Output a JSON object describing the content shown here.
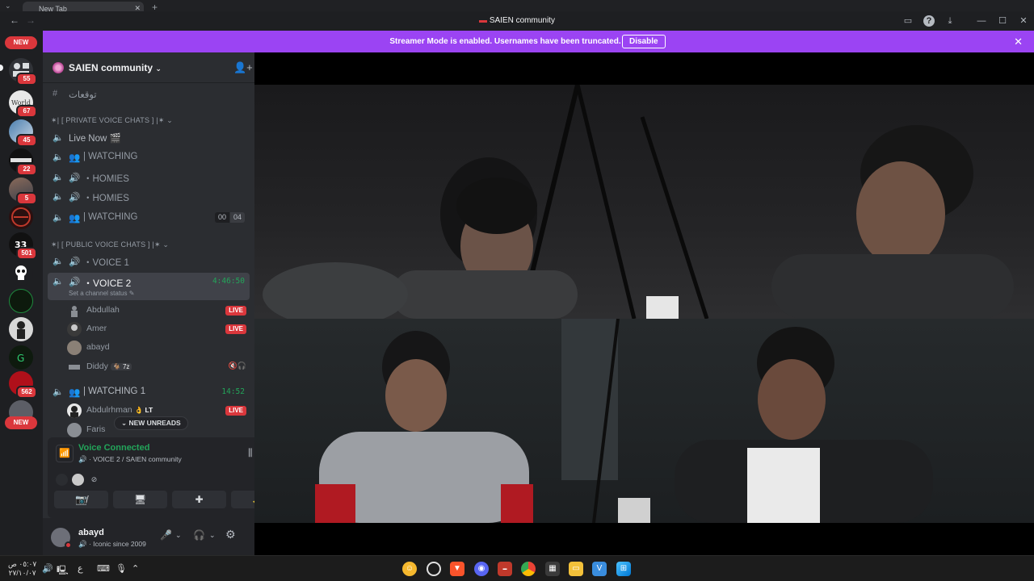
{
  "browser": {
    "tab_title": "New Tab"
  },
  "window": {
    "title": "SAIEN community"
  },
  "banner": {
    "text": "Streamer Mode is enabled. Usernames have been truncated.",
    "button": "Disable"
  },
  "rail": {
    "new_top": "NEW",
    "new_bottom": "NEW",
    "badges": [
      "55",
      "67",
      "45",
      "22",
      "5",
      "501",
      "562"
    ]
  },
  "sidebar": {
    "server_name": "SAIEN community",
    "arabic_channel": "توقعات",
    "cat_private": "✶| [ PRIVATE VOICE CHATS ] |✶",
    "live_now": "Live Now 🎬",
    "private_channels": [
      "| WATCHING",
      "・HOMIES",
      "・HOMIES",
      "| WATCHING"
    ],
    "watching_counts": [
      "00",
      "04"
    ],
    "cat_public": "✶| [ PUBLIC VOICE CHATS ] |✶",
    "voice1": "・VOICE 1",
    "voice2": "・VOICE 2",
    "voice2_timer": "4:46:50",
    "channel_status": "Set a channel status",
    "voice2_users": [
      {
        "name": "Abdullah",
        "live": "LIVE"
      },
      {
        "name": "Amer",
        "live": "LIVE"
      },
      {
        "name": "abayd",
        "live": ""
      },
      {
        "name": "Diddy",
        "tag": "7z"
      }
    ],
    "watching1": "| WATCHING 1",
    "watching1_timer": "14:52",
    "watching1_users": [
      {
        "name": "Abdulrhman",
        "tag": "LT",
        "live": "LIVE"
      },
      {
        "name": "Faris"
      }
    ],
    "new_unreads": "NEW UNREADS"
  },
  "voice_panel": {
    "status": "Voice Connected",
    "location": "VOICE 2 / SAIEN community"
  },
  "user_bar": {
    "name": "abayd",
    "status": "Iconic since 2009"
  },
  "taskbar": {
    "clock_time": "٠٥:٠٧ ص",
    "clock_date": "٢٧/١٠/٠٧",
    "lang": "ع"
  },
  "colors": {
    "banner": "#9b44f3",
    "live": "#da373c",
    "connected": "#23a55a"
  }
}
